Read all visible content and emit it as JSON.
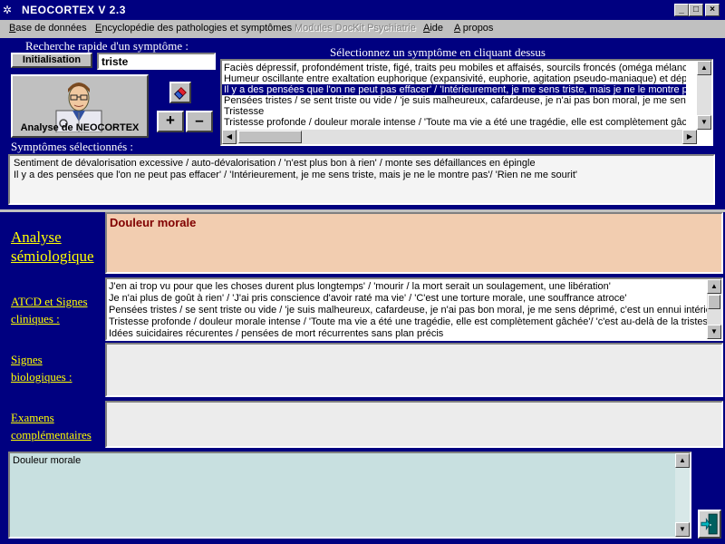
{
  "window": {
    "title": "NEOCORTEX  V 2.3",
    "min_glyph": "_",
    "max_glyph": "□",
    "close_glyph": "×"
  },
  "menu": {
    "items": [
      {
        "label_u": "B",
        "label_rest": "ase de données",
        "enabled": true
      },
      {
        "label_u": "E",
        "label_rest": "ncyclopédie des pathologies et symptômes",
        "enabled": true
      },
      {
        "label_u": "",
        "label_rest": "Modules DocKit Psychiatrie",
        "enabled": false
      },
      {
        "label_u": "A",
        "label_rest": "ide",
        "enabled": true
      },
      {
        "label_u": "A",
        "label_rest": " propos",
        "enabled": true
      }
    ]
  },
  "search": {
    "heading": "Recherche rapide d'un symptôme :",
    "init_button": "Initialisation",
    "query": "triste"
  },
  "symptom_picker": {
    "heading": "Sélectionnez un symptôme en cliquant dessus",
    "items": [
      "Faciès dépressif, profondément triste, figé, traits peu mobiles et affaisés, sourcils froncés (oméga mélancolique)",
      "Humeur oscillante entre exaltation euphorique (expansivité, euphorie, agitation pseudo-maniaque) et dépression",
      "Il y a des pensées que l'on ne peut pas effacer' / 'Intérieurement, je me sens triste, mais je ne le montre pas'/ 'Ri",
      "Pensées tristes / se sent triste ou vide / 'je suis malheureux, cafardeuse, je n'ai pas bon moral, je me sens dépri",
      "Tristesse",
      "Tristesse profonde / douleur morale intense / 'Toute ma vie a été une tragédie,  elle est complètement gâchée'/"
    ],
    "selected_index": 2
  },
  "analysis_button": "Analyse de NEOCORTEX",
  "controls": {
    "plus": "+",
    "minus": "–"
  },
  "selected_symptoms": {
    "heading": "Symptômes sélectionnés :",
    "items": [
      "Sentiment de dévalorisation excessive / auto-dévalorisation / 'n'est plus bon à rien' / monte ses défaillances en épingle",
      "Il y a des pensées que l'on ne peut pas effacer' / 'Intérieurement, je me sens triste, mais je ne le montre pas'/ 'Rien ne me sourit'"
    ]
  },
  "sections": {
    "semiology": {
      "label_line1": "Analyse",
      "label_line2": "sémiologique",
      "result": "Douleur morale"
    },
    "atcd": {
      "label_line1": "ATCD et Signes",
      "label_line2": "cliniques :",
      "items": [
        "J'en ai trop vu pour que les choses durent plus longtemps' / 'mourir / la mort serait un soulagement, une libération'",
        "Je n'ai plus de goût à rien' / 'J'ai pris conscience d'avoir raté ma vie' / 'C'est une torture morale, une souffrance atroce'",
        "Pensées tristes / se sent triste ou vide / 'je suis malheureux, cafardeuse, je n'ai pas bon moral, je me sens déprimé, c'est un ennui intérieur'",
        "Tristesse profonde / douleur morale intense / 'Toute ma vie a été une tragédie,  elle est complètement gâchée'/ 'c'est au-delà de la tristesse'",
        "Idées suicidaires récurentes / pensées de mort récurrentes sans plan précis"
      ]
    },
    "bio": {
      "label_line1": "Signes",
      "label_line2": "biologiques :"
    },
    "exams": {
      "label_line1": "Examens",
      "label_line2": "complémentaires"
    }
  },
  "notes": {
    "text": "Douleur morale"
  },
  "colors": {
    "background": "#000080",
    "label_yellow": "#ffff00",
    "analysis_bg": "#f2cdb0",
    "headline": "#800000",
    "notes_bg": "#c8e0e0"
  }
}
